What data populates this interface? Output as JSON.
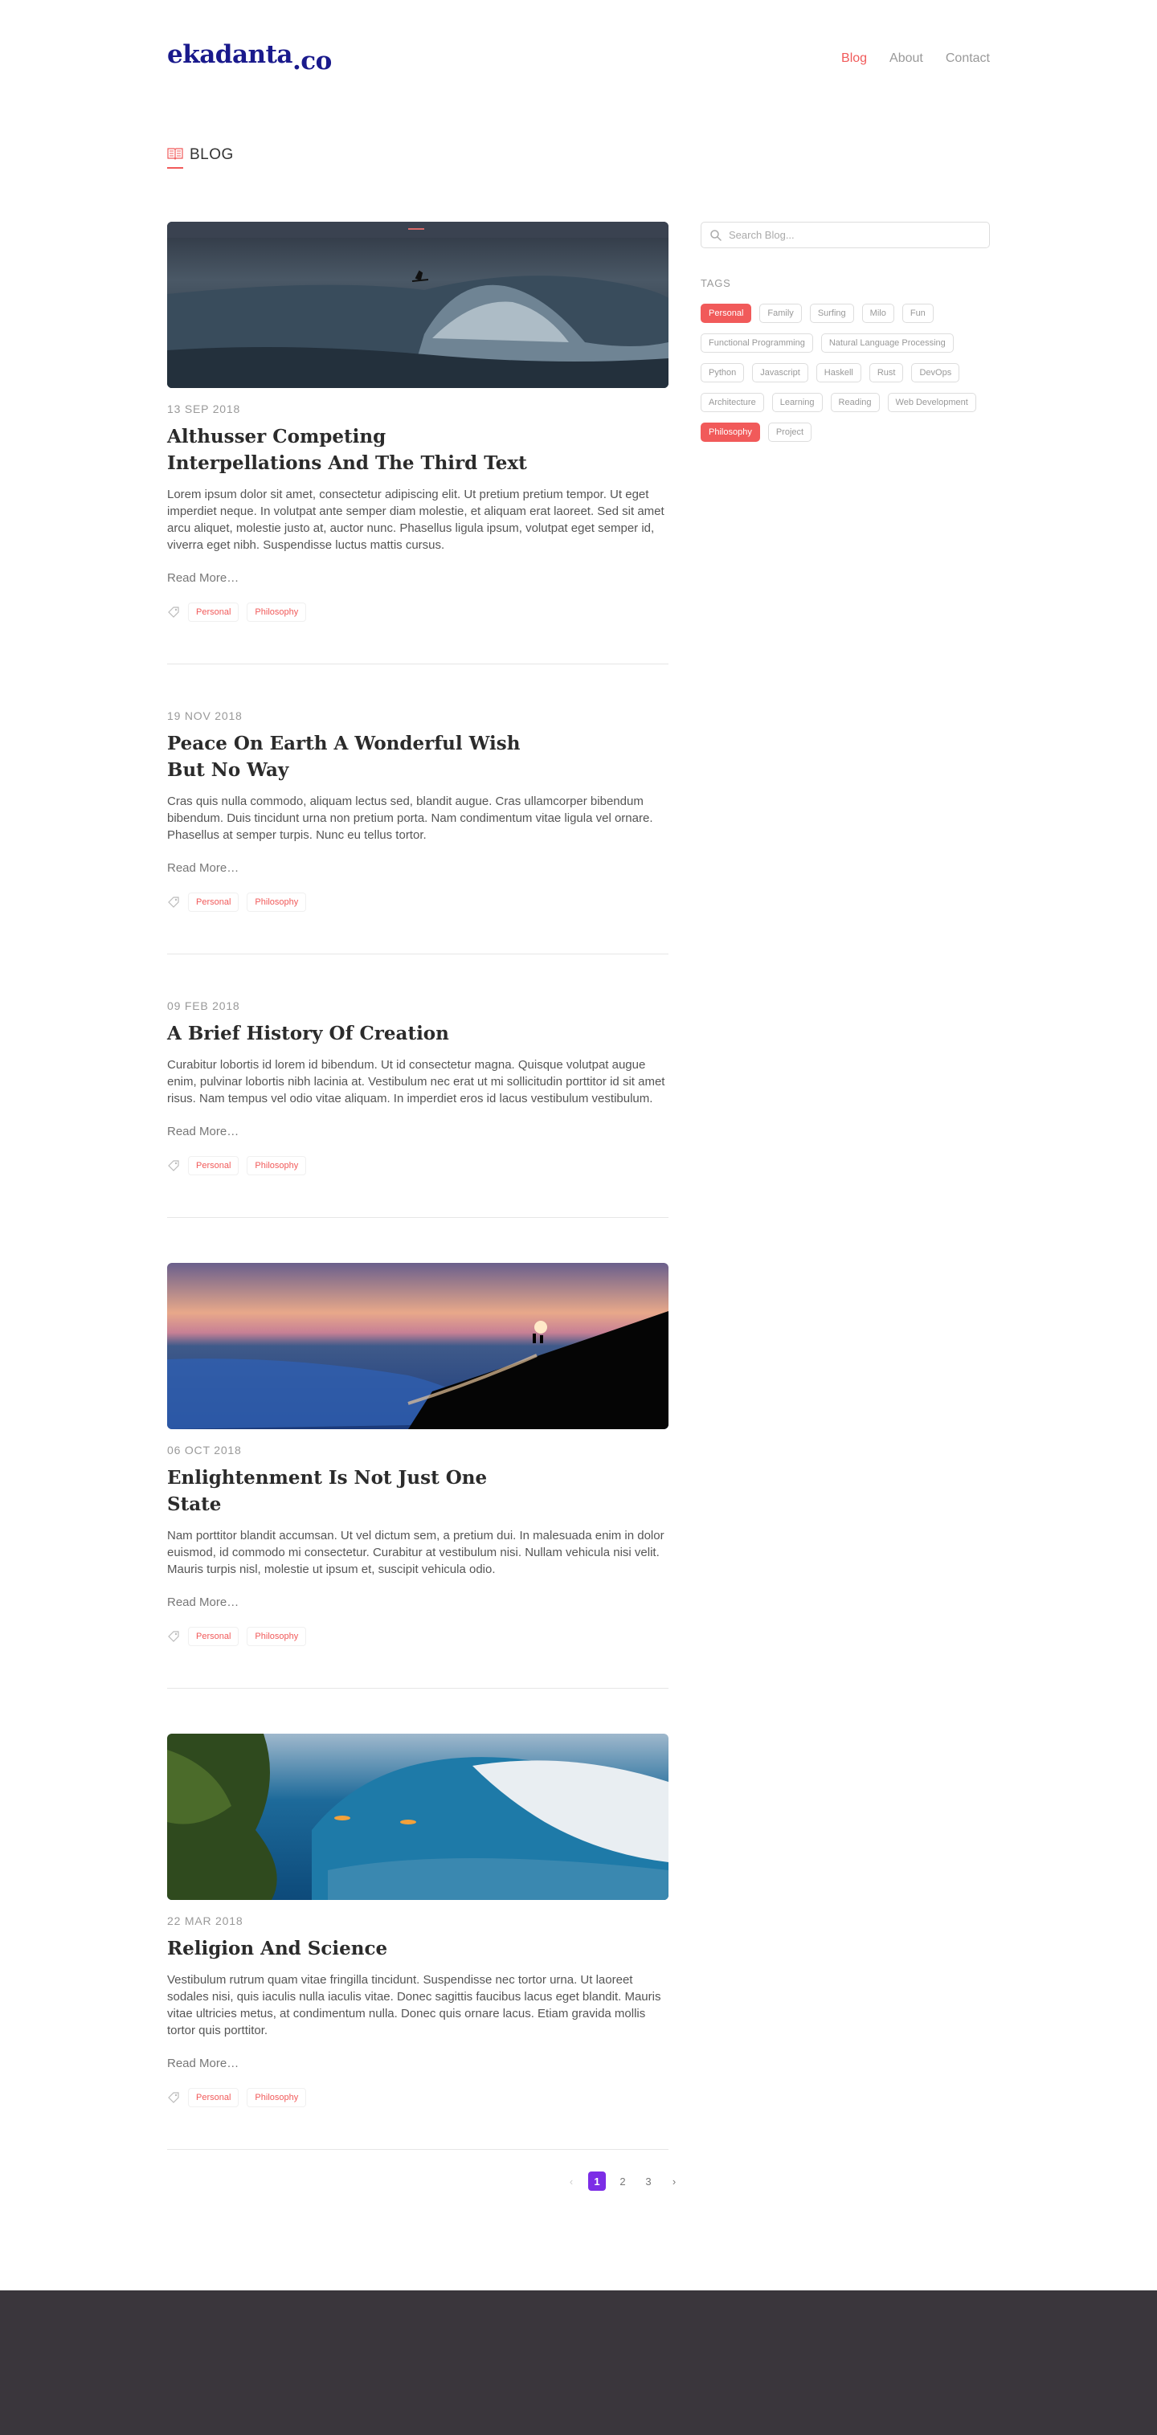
{
  "brand": {
    "name": "ekadanta",
    "tld": ".co"
  },
  "nav": [
    {
      "label": "Blog",
      "active": true
    },
    {
      "label": "About",
      "active": false
    },
    {
      "label": "Contact",
      "active": false
    }
  ],
  "page": {
    "title": "BLOG",
    "icon": "book-icon"
  },
  "posts": [
    {
      "has_image": true,
      "image": "surfer-on-wave-dusk",
      "date": "13 SEP 2018",
      "title": "Althusser Competing Interpellations And The Third Text",
      "excerpt": "Lorem ipsum dolor sit amet, consectetur adipiscing elit. Ut pretium pretium tempor. Ut eget imperdiet neque. In volutpat ante semper diam molestie, et aliquam erat laoreet. Sed sit amet arcu aliquet, molestie justo at, auctor nunc. Phasellus ligula ipsum, volutpat eget semper id, viverra eget nibh. Suspendisse luctus mattis cursus.",
      "read_more": "Read More…",
      "tags": [
        "Personal",
        "Philosophy"
      ]
    },
    {
      "has_image": false,
      "date": "19 NOV 2018",
      "title": "Peace On Earth A Wonderful Wish But No Way",
      "excerpt": "Cras quis nulla commodo, aliquam lectus sed, blandit augue. Cras ullamcorper bibendum bibendum. Duis tincidunt urna non pretium porta. Nam condimentum vitae ligula vel ornare. Phasellus at semper turpis. Nunc eu tellus tortor.",
      "read_more": "Read More…",
      "tags": [
        "Personal",
        "Philosophy"
      ]
    },
    {
      "has_image": false,
      "date": "09 FEB 2018",
      "title": "A Brief History Of Creation",
      "excerpt": "Curabitur lobortis id lorem id bibendum. Ut id consectetur magna. Quisque volutpat augue enim, pulvinar lobortis nibh lacinia at. Vestibulum nec erat ut mi sollicitudin porttitor id sit amet risus. Nam tempus vel odio vitae aliquam. In imperdiet eros id lacus vestibulum vestibulum.",
      "read_more": "Read More…",
      "tags": [
        "Personal",
        "Philosophy"
      ]
    },
    {
      "has_image": true,
      "image": "beach-sunset",
      "date": "06 OCT 2018",
      "title": "Enlightenment Is Not Just One State",
      "excerpt": "Nam porttitor blandit accumsan. Ut vel dictum sem, a pretium dui. In malesuada enim in dolor euismod, id commodo mi consectetur. Curabitur at vestibulum nisi. Nullam vehicula nisi velit. Mauris turpis nisl, molestie ut ipsum et, suscipit vehicula odio.",
      "read_more": "Read More…",
      "tags": [
        "Personal",
        "Philosophy"
      ]
    },
    {
      "has_image": true,
      "image": "big-wave-surfers",
      "date": "22 MAR 2018",
      "title": "Religion And Science",
      "excerpt": "Vestibulum rutrum quam vitae fringilla tincidunt. Suspendisse nec tortor urna. Ut laoreet sodales nisi, quis iaculis nulla iaculis vitae. Donec sagittis faucibus lacus eget blandit. Mauris vitae ultricies metus, at condimentum nulla. Donec quis ornare lacus. Etiam gravida mollis tortor quis porttitor.",
      "read_more": "Read More…",
      "tags": [
        "Personal",
        "Philosophy"
      ]
    }
  ],
  "pagination": {
    "prev": "‹",
    "pages": [
      "1",
      "2",
      "3"
    ],
    "current": "1",
    "next": "›"
  },
  "sidebar": {
    "search_placeholder": "Search Blog...",
    "tags_heading": "TAGS",
    "tags": [
      {
        "label": "Personal",
        "active": true
      },
      {
        "label": "Family",
        "active": false
      },
      {
        "label": "Surfing",
        "active": false
      },
      {
        "label": "Milo",
        "active": false
      },
      {
        "label": "Fun",
        "active": false
      },
      {
        "label": "Functional Programming",
        "active": false
      },
      {
        "label": "Natural Language Processing",
        "active": false
      },
      {
        "label": "Python",
        "active": false
      },
      {
        "label": "Javascript",
        "active": false
      },
      {
        "label": "Haskell",
        "active": false
      },
      {
        "label": "Rust",
        "active": false
      },
      {
        "label": "DevOps",
        "active": false
      },
      {
        "label": "Architecture",
        "active": false
      },
      {
        "label": "Learning",
        "active": false
      },
      {
        "label": "Reading",
        "active": false
      },
      {
        "label": "Web Development",
        "active": false
      },
      {
        "label": "Philosophy",
        "active": true
      },
      {
        "label": "Project",
        "active": false
      }
    ]
  },
  "colors": {
    "accent": "#f15a5a",
    "brand": "#1a1a8c",
    "pager_active": "#7c2de6",
    "footer": "#3a363c"
  }
}
